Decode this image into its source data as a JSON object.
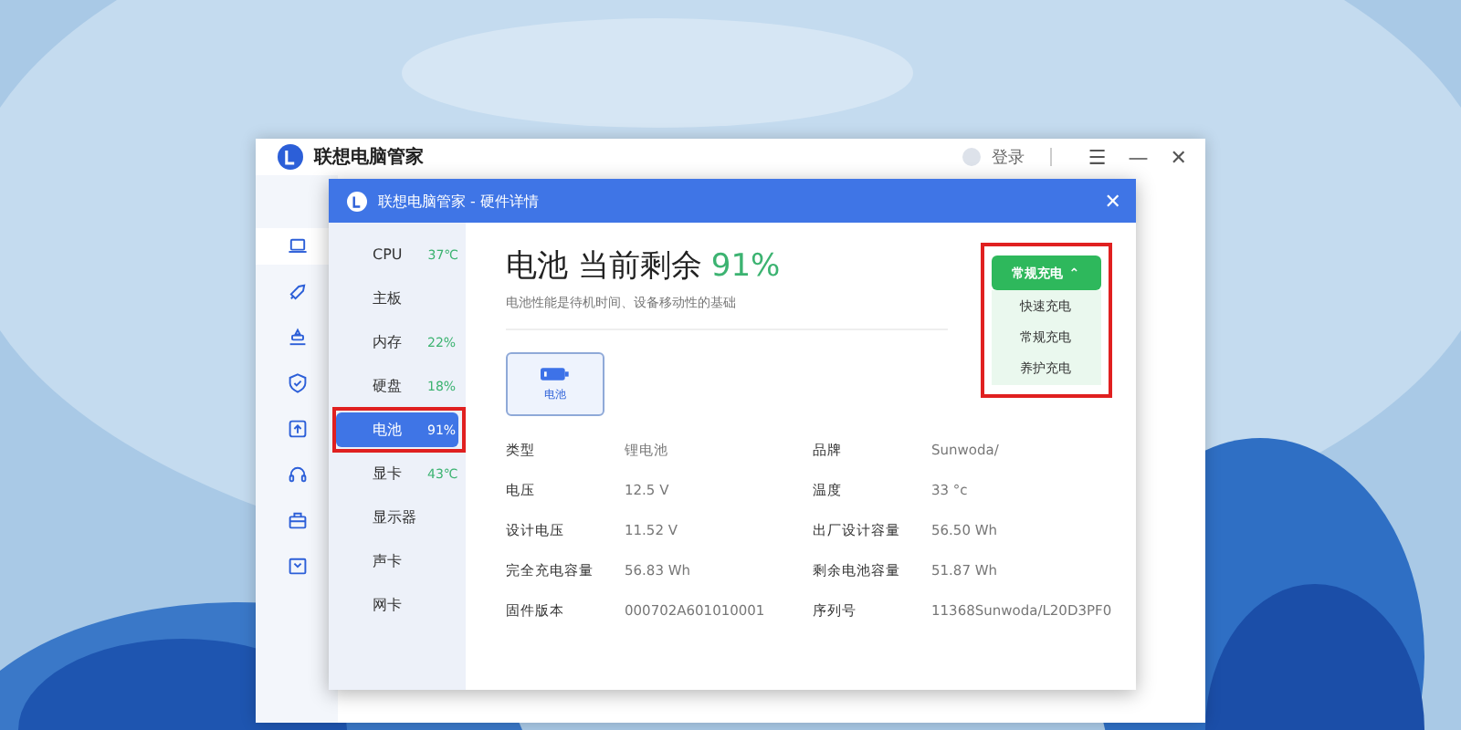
{
  "main_window": {
    "app_name": "联想电脑管家",
    "login": "登录",
    "controls": [
      "☰",
      "—",
      "✕"
    ],
    "nav_icons": [
      {
        "kind": "laptop",
        "selected": true
      },
      {
        "kind": "rocket",
        "selected": false
      },
      {
        "kind": "stack",
        "selected": false
      },
      {
        "kind": "shield",
        "selected": false
      },
      {
        "kind": "upload",
        "selected": false
      },
      {
        "kind": "headset",
        "selected": false
      },
      {
        "kind": "briefcase",
        "selected": false
      },
      {
        "kind": "box",
        "selected": false
      }
    ]
  },
  "dialog": {
    "title": "联想电脑管家 - 硬件详情",
    "close": "✕",
    "sidebar": [
      {
        "name": "CPU",
        "value": "37℃",
        "selected": false,
        "highlighted": false
      },
      {
        "name": "主板",
        "selected": false,
        "highlighted": false
      },
      {
        "name": "内存",
        "value": "22%",
        "selected": false,
        "highlighted": false
      },
      {
        "name": "硬盘",
        "value": "18%",
        "selected": false,
        "highlighted": false
      },
      {
        "name": "电池",
        "value": "91%",
        "selected": true,
        "highlighted": true
      },
      {
        "name": "显卡",
        "value": "43℃",
        "selected": false,
        "highlighted": false
      },
      {
        "name": "显示器",
        "selected": false,
        "highlighted": false
      },
      {
        "name": "声卡",
        "selected": false,
        "highlighted": false
      },
      {
        "name": "网卡",
        "selected": false,
        "highlighted": false
      }
    ],
    "heading": "电池 当前剩余",
    "heading_value": "91%",
    "subtitle": "电池性能是待机时间、设备移动性的基础",
    "tiles": [
      {
        "label": "电池",
        "selected": true
      }
    ],
    "charge_mode": {
      "button": "常规充电",
      "caret": "⌃",
      "expanded": true,
      "highlighted": true,
      "options": [
        "快速充电",
        "常规充电",
        "养护充电"
      ]
    },
    "details": [
      {
        "label": "类型",
        "value": "锂电池",
        "label_2": "品牌",
        "value_2": "Sunwoda/"
      },
      {
        "label": "电压",
        "value": "12.5 V",
        "label_2": "温度",
        "value_2": "33 °c"
      },
      {
        "label": "设计电压",
        "value": "11.52 V",
        "label_2": "出厂设计容量",
        "value_2": "56.50 Wh"
      },
      {
        "label": "完全充电容量",
        "value": "56.83 Wh",
        "label_2": "剩余电池容量",
        "value_2": "51.87 Wh"
      },
      {
        "label": "固件版本",
        "value": "000702A601010001",
        "label_2": "序列号",
        "value_2": "11368Sunwoda/L20D3PF0"
      }
    ]
  }
}
